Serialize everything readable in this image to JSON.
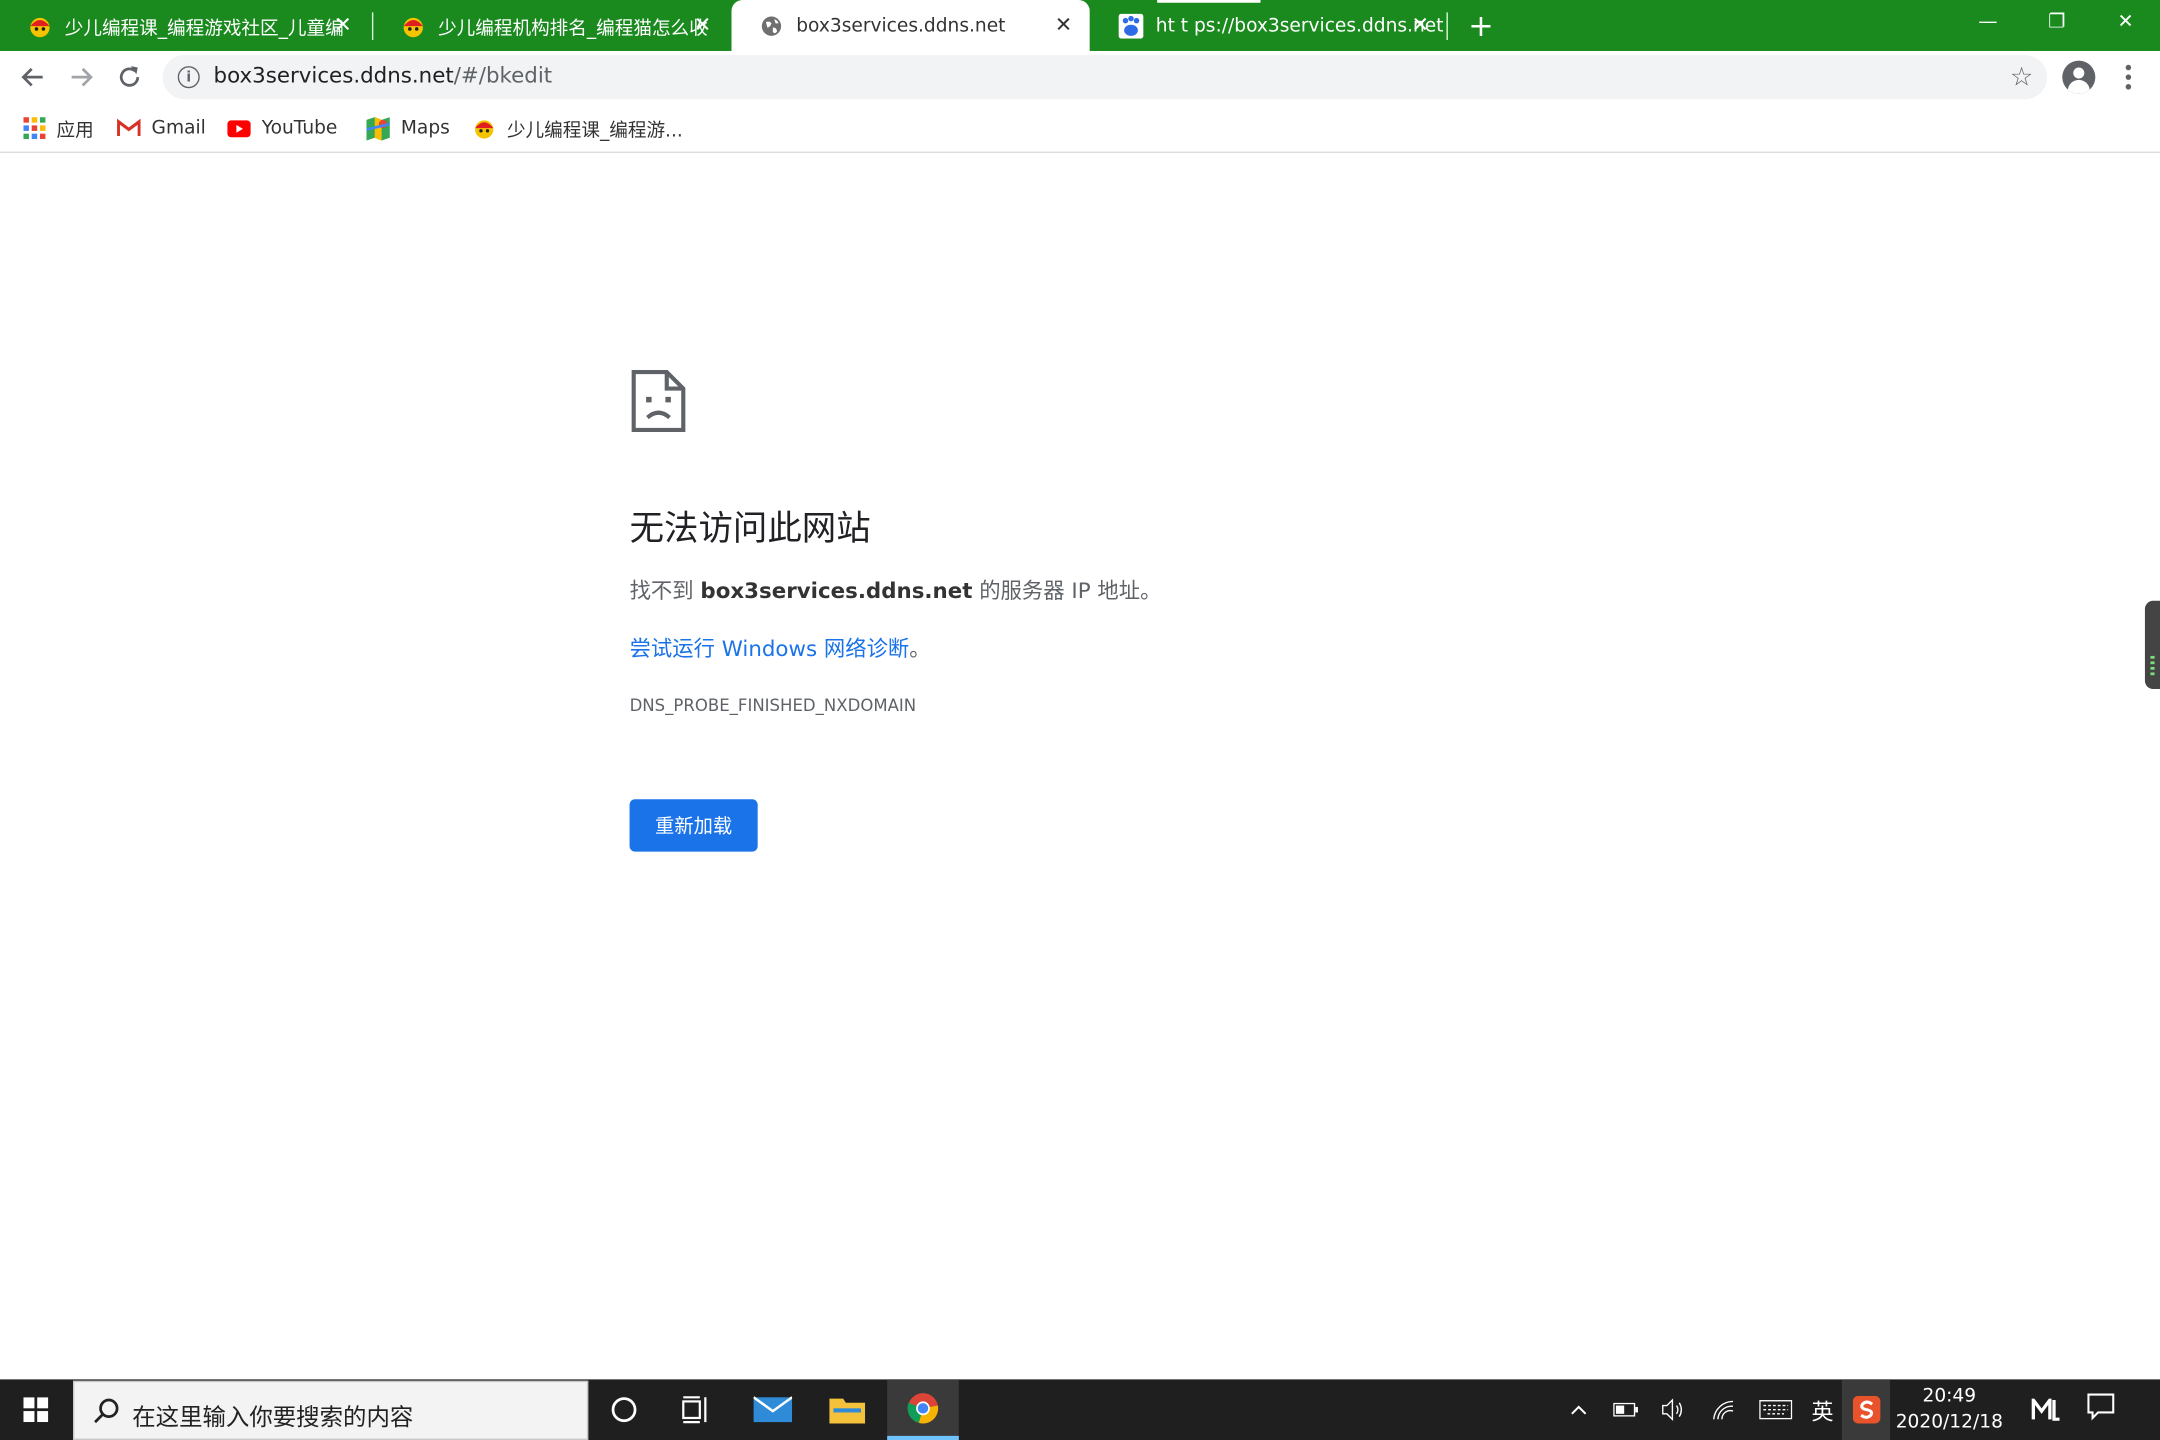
{
  "browser": {
    "tabs": [
      {
        "title": "少儿编程课_编程游戏社区_儿童编",
        "icon": "codemao-icon",
        "active": false
      },
      {
        "title": "少儿编程机构排名_编程猫怎么收",
        "icon": "codemao-icon",
        "active": false
      },
      {
        "title": "box3services.ddns.net",
        "icon": "globe-icon",
        "active": true
      },
      {
        "title": "ht t ps://box3services.ddns.net",
        "icon": "baidu-paw-icon",
        "active": false
      }
    ],
    "new_tab_label": "+",
    "window_controls": {
      "minimize": "—",
      "restore": "❐",
      "close": "✕"
    },
    "url_host": "box3services.ddns.net",
    "url_path": "/#/bkedit",
    "bookmarks": [
      {
        "label": "应用",
        "icon": "apps-grid-icon"
      },
      {
        "label": "Gmail",
        "icon": "gmail-icon"
      },
      {
        "label": "YouTube",
        "icon": "youtube-icon"
      },
      {
        "label": "Maps",
        "icon": "maps-icon"
      },
      {
        "label": "少儿编程课_编程游...",
        "icon": "codemao-icon"
      }
    ]
  },
  "error_page": {
    "title": "无法访问此网站",
    "desc_prefix": "找不到 ",
    "desc_host": "box3services.ddns.net",
    "desc_suffix": " 的服务器 IP 地址。",
    "link_text": "尝试运行 Windows 网络诊断",
    "link_suffix": "。",
    "error_code": "DNS_PROBE_FINISHED_NXDOMAIN",
    "reload_label": "重新加载"
  },
  "taskbar": {
    "search_placeholder": "在这里输入你要搜索的内容",
    "ime_label": "英",
    "time": "20:49",
    "date": "2020/12/18"
  },
  "colors": {
    "tab_strip": "#1a8a1f",
    "link": "#1a73e8",
    "button": "#1a73e8",
    "taskbar": "#1f1f1f"
  }
}
